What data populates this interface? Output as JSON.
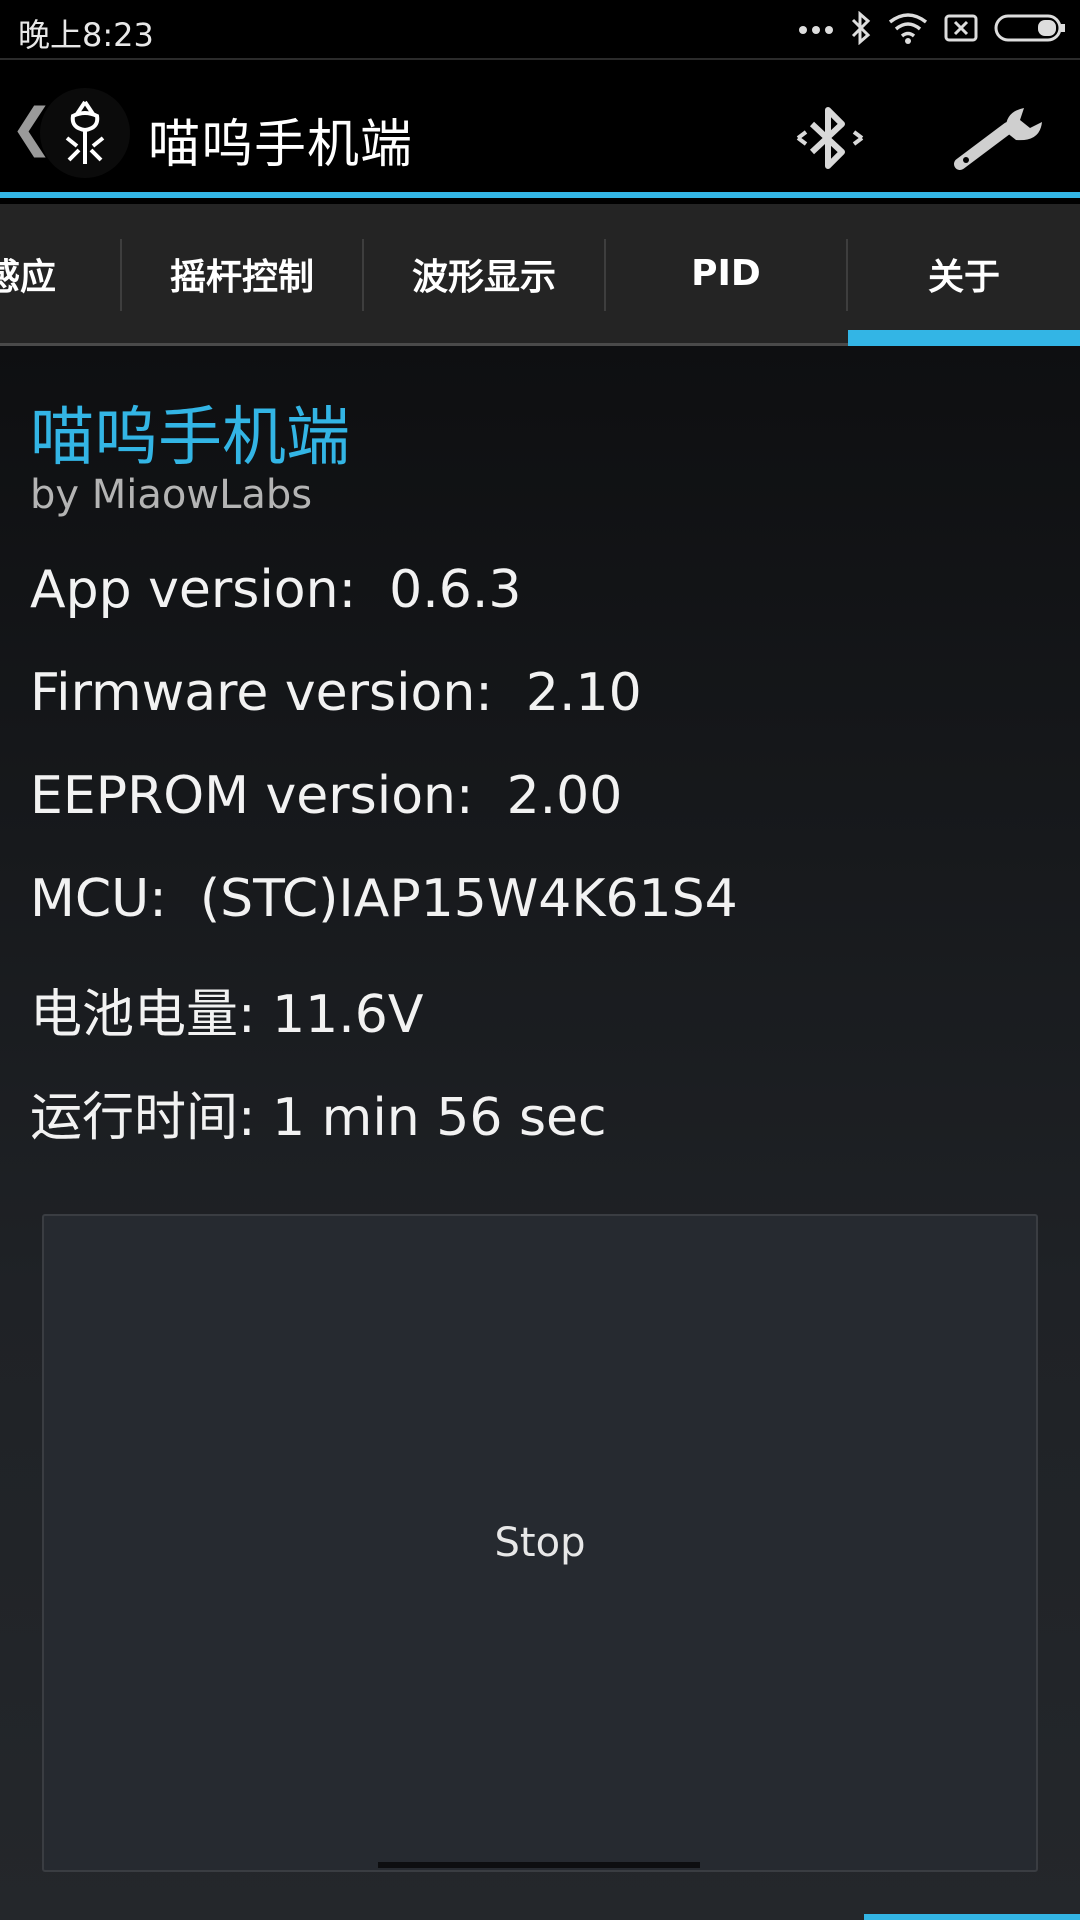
{
  "status_bar": {
    "time": "晚上8:23",
    "icons": [
      "more-dots-icon",
      "bluetooth-icon",
      "wifi-icon",
      "no-sim-icon",
      "battery-icon"
    ]
  },
  "action_bar": {
    "back_symbol": "❮",
    "title": "喵呜手机端",
    "actions": [
      "bluetooth-icon",
      "wrench-icon"
    ]
  },
  "tabs": [
    {
      "label": "感应",
      "selected": false
    },
    {
      "label": "摇杆控制",
      "selected": false
    },
    {
      "label": "波形显示",
      "selected": false
    },
    {
      "label": "PID",
      "selected": false
    },
    {
      "label": "关于",
      "selected": true
    }
  ],
  "about": {
    "title": "喵呜手机端",
    "subtitle": "by MiaowLabs",
    "rows": [
      {
        "label": "App version:",
        "value": "0.6.3"
      },
      {
        "label": "Firmware version:",
        "value": "2.10"
      },
      {
        "label": "EEPROM version:",
        "value": "2.00"
      },
      {
        "label": "MCU:",
        "value": "(STC)IAP15W4K61S4"
      },
      {
        "label": "电池电量:",
        "value": "11.6V"
      },
      {
        "label": "运行时间:",
        "value": "1 min 56 sec"
      }
    ]
  },
  "stop_button": {
    "label": "Stop"
  },
  "colors": {
    "accent": "#33b5e5",
    "background": "#000000",
    "tab_bg": "#242424"
  }
}
